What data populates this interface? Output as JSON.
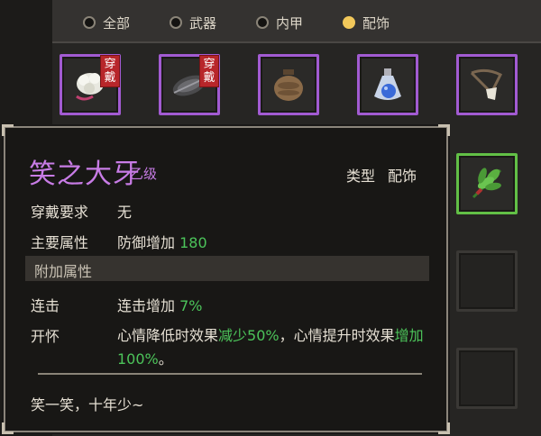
{
  "filter_tabs": [
    {
      "label": "全部",
      "selected": false
    },
    {
      "label": "武器",
      "selected": false
    },
    {
      "label": "内甲",
      "selected": false
    },
    {
      "label": "配饰",
      "selected": true
    }
  ],
  "inventory": {
    "worn_badge": "穿戴",
    "slots": [
      {
        "icon": "white-tuft-charm-icon",
        "worn": true
      },
      {
        "icon": "dark-feather-icon",
        "worn": true
      },
      {
        "icon": "clay-jar-icon",
        "worn": false
      },
      {
        "icon": "blue-potion-flask-icon",
        "worn": false
      },
      {
        "icon": "cord-pendant-icon",
        "worn": false
      },
      {
        "icon": "herb-bundle-icon",
        "worn": false
      }
    ]
  },
  "tooltip": {
    "name": "笑之大牙",
    "grade": "乙级",
    "type_label": "类型",
    "type_value": "配饰",
    "requirement_label": "穿戴要求",
    "requirement_value": "无",
    "main_attr_label": "主要属性",
    "main_attr_text": "防御增加",
    "main_attr_value": "180",
    "extra_section_title": "附加属性",
    "combo_label": "连击",
    "combo_text": "连击增加",
    "combo_value": "7%",
    "cheer_label": "开怀",
    "cheer_desc_1": "心情降低时效果",
    "cheer_desc_2": "减少50%",
    "cheer_desc_3": "，心情提升时效果",
    "cheer_desc_4": "增加100%",
    "cheer_desc_5": "。",
    "flavor_text": "笑一笑，十年少~"
  },
  "colors": {
    "purple_rarity": "#a25bd2",
    "green_rarity": "#62c046",
    "highlight_green": "#4cc45a",
    "item_name": "#c87ce6",
    "selected_radio": "#f2c85a",
    "worn_badge": "#b8262a"
  }
}
